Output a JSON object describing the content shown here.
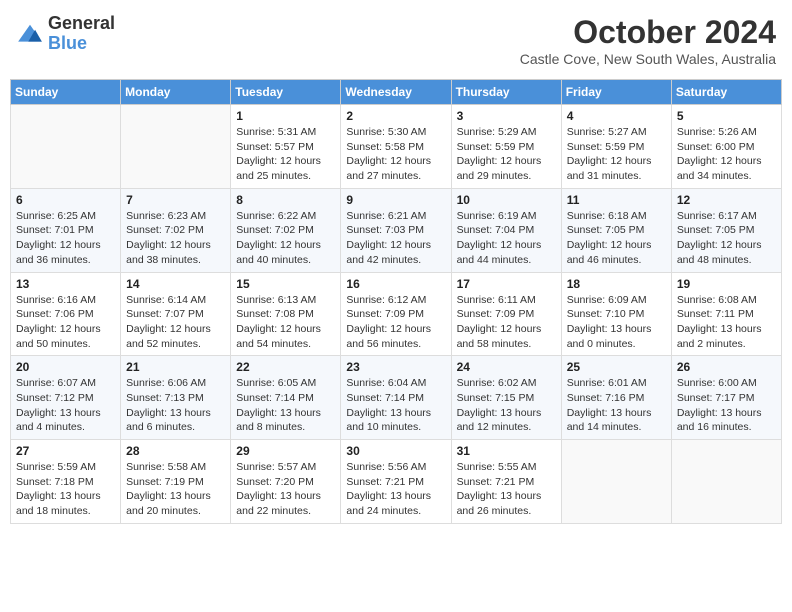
{
  "logo": {
    "text_general": "General",
    "text_blue": "Blue"
  },
  "header": {
    "title": "October 2024",
    "subtitle": "Castle Cove, New South Wales, Australia"
  },
  "columns": [
    "Sunday",
    "Monday",
    "Tuesday",
    "Wednesday",
    "Thursday",
    "Friday",
    "Saturday"
  ],
  "weeks": [
    [
      {
        "day": "",
        "info": ""
      },
      {
        "day": "",
        "info": ""
      },
      {
        "day": "1",
        "info": "Sunrise: 5:31 AM\nSunset: 5:57 PM\nDaylight: 12 hours\nand 25 minutes."
      },
      {
        "day": "2",
        "info": "Sunrise: 5:30 AM\nSunset: 5:58 PM\nDaylight: 12 hours\nand 27 minutes."
      },
      {
        "day": "3",
        "info": "Sunrise: 5:29 AM\nSunset: 5:59 PM\nDaylight: 12 hours\nand 29 minutes."
      },
      {
        "day": "4",
        "info": "Sunrise: 5:27 AM\nSunset: 5:59 PM\nDaylight: 12 hours\nand 31 minutes."
      },
      {
        "day": "5",
        "info": "Sunrise: 5:26 AM\nSunset: 6:00 PM\nDaylight: 12 hours\nand 34 minutes."
      }
    ],
    [
      {
        "day": "6",
        "info": "Sunrise: 6:25 AM\nSunset: 7:01 PM\nDaylight: 12 hours\nand 36 minutes."
      },
      {
        "day": "7",
        "info": "Sunrise: 6:23 AM\nSunset: 7:02 PM\nDaylight: 12 hours\nand 38 minutes."
      },
      {
        "day": "8",
        "info": "Sunrise: 6:22 AM\nSunset: 7:02 PM\nDaylight: 12 hours\nand 40 minutes."
      },
      {
        "day": "9",
        "info": "Sunrise: 6:21 AM\nSunset: 7:03 PM\nDaylight: 12 hours\nand 42 minutes."
      },
      {
        "day": "10",
        "info": "Sunrise: 6:19 AM\nSunset: 7:04 PM\nDaylight: 12 hours\nand 44 minutes."
      },
      {
        "day": "11",
        "info": "Sunrise: 6:18 AM\nSunset: 7:05 PM\nDaylight: 12 hours\nand 46 minutes."
      },
      {
        "day": "12",
        "info": "Sunrise: 6:17 AM\nSunset: 7:05 PM\nDaylight: 12 hours\nand 48 minutes."
      }
    ],
    [
      {
        "day": "13",
        "info": "Sunrise: 6:16 AM\nSunset: 7:06 PM\nDaylight: 12 hours\nand 50 minutes."
      },
      {
        "day": "14",
        "info": "Sunrise: 6:14 AM\nSunset: 7:07 PM\nDaylight: 12 hours\nand 52 minutes."
      },
      {
        "day": "15",
        "info": "Sunrise: 6:13 AM\nSunset: 7:08 PM\nDaylight: 12 hours\nand 54 minutes."
      },
      {
        "day": "16",
        "info": "Sunrise: 6:12 AM\nSunset: 7:09 PM\nDaylight: 12 hours\nand 56 minutes."
      },
      {
        "day": "17",
        "info": "Sunrise: 6:11 AM\nSunset: 7:09 PM\nDaylight: 12 hours\nand 58 minutes."
      },
      {
        "day": "18",
        "info": "Sunrise: 6:09 AM\nSunset: 7:10 PM\nDaylight: 13 hours\nand 0 minutes."
      },
      {
        "day": "19",
        "info": "Sunrise: 6:08 AM\nSunset: 7:11 PM\nDaylight: 13 hours\nand 2 minutes."
      }
    ],
    [
      {
        "day": "20",
        "info": "Sunrise: 6:07 AM\nSunset: 7:12 PM\nDaylight: 13 hours\nand 4 minutes."
      },
      {
        "day": "21",
        "info": "Sunrise: 6:06 AM\nSunset: 7:13 PM\nDaylight: 13 hours\nand 6 minutes."
      },
      {
        "day": "22",
        "info": "Sunrise: 6:05 AM\nSunset: 7:14 PM\nDaylight: 13 hours\nand 8 minutes."
      },
      {
        "day": "23",
        "info": "Sunrise: 6:04 AM\nSunset: 7:14 PM\nDaylight: 13 hours\nand 10 minutes."
      },
      {
        "day": "24",
        "info": "Sunrise: 6:02 AM\nSunset: 7:15 PM\nDaylight: 13 hours\nand 12 minutes."
      },
      {
        "day": "25",
        "info": "Sunrise: 6:01 AM\nSunset: 7:16 PM\nDaylight: 13 hours\nand 14 minutes."
      },
      {
        "day": "26",
        "info": "Sunrise: 6:00 AM\nSunset: 7:17 PM\nDaylight: 13 hours\nand 16 minutes."
      }
    ],
    [
      {
        "day": "27",
        "info": "Sunrise: 5:59 AM\nSunset: 7:18 PM\nDaylight: 13 hours\nand 18 minutes."
      },
      {
        "day": "28",
        "info": "Sunrise: 5:58 AM\nSunset: 7:19 PM\nDaylight: 13 hours\nand 20 minutes."
      },
      {
        "day": "29",
        "info": "Sunrise: 5:57 AM\nSunset: 7:20 PM\nDaylight: 13 hours\nand 22 minutes."
      },
      {
        "day": "30",
        "info": "Sunrise: 5:56 AM\nSunset: 7:21 PM\nDaylight: 13 hours\nand 24 minutes."
      },
      {
        "day": "31",
        "info": "Sunrise: 5:55 AM\nSunset: 7:21 PM\nDaylight: 13 hours\nand 26 minutes."
      },
      {
        "day": "",
        "info": ""
      },
      {
        "day": "",
        "info": ""
      }
    ]
  ]
}
